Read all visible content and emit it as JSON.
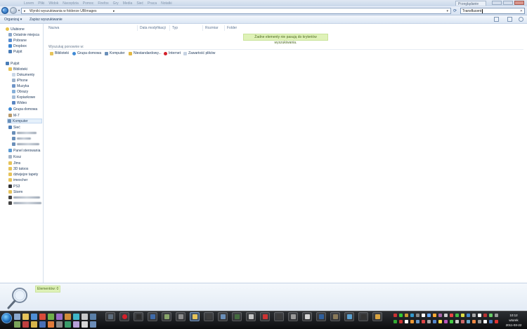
{
  "window": {
    "menu_items": [
      "Lorem",
      "Pliki",
      "Widok",
      "Narzędzia",
      "Pomoc",
      "Firefox",
      "Gry",
      "Media",
      "Sieć",
      "Praca",
      "Notatki"
    ],
    "tab_title": "Przeglądanie"
  },
  "address": {
    "path_text": "Wyniki wyszukiwania w folderze UBImages",
    "search_value": "Transflucent",
    "refresh_icon": "refresh-icon",
    "clear_icon": "clear-icon"
  },
  "toolbar": {
    "organize_label": "Organizuj ▾",
    "save_search_label": "Zapisz wyszukiwanie"
  },
  "sidebar": {
    "favorites_header": "Ulubione",
    "favorites": [
      "Ostatnie miejsca",
      "Pobrane",
      "Dropbox",
      "Pulpit"
    ],
    "desktop_header": "Pulpit",
    "libraries": "Biblioteki",
    "library_items": [
      "Dokumenty",
      "iPhone",
      "Muzyka",
      "Obrazy",
      "Kopiarkowe",
      "Wideo"
    ],
    "homegroup": "Grupa domowa",
    "user": "M-7",
    "computer": "Komputer",
    "network": "Sieć",
    "control_panel": "Panel sterowania",
    "folders": [
      "Kosz",
      "Jlms",
      "3D tatoos",
      "dziwjejze tapety",
      "imexcher",
      "PS3",
      "Storm"
    ]
  },
  "columns": [
    "Nazwa",
    "Data modyfikacji",
    "Typ",
    "Rozmiar",
    "Folder"
  ],
  "empty_message": "Żadne elementy nie pasują do kryteriów wyszukiwania.",
  "search_again": {
    "label": "Wyszukaj ponownie w:",
    "items": [
      "Biblioteki",
      "Grupa domowa",
      "Komputer",
      "Niestandardowy...",
      "Internet",
      "Zawartość plików"
    ]
  },
  "details": {
    "count": "Elementów: 0",
    "icon": "magnifier-icon"
  },
  "taskbar": {
    "clock_time": "10:12",
    "clock_day": "wtorek",
    "clock_date": "2011-03-22"
  },
  "colors": {
    "accent": "#1e395b",
    "highlight": "#dff2b8",
    "taskbar": "#0c0d0f"
  }
}
